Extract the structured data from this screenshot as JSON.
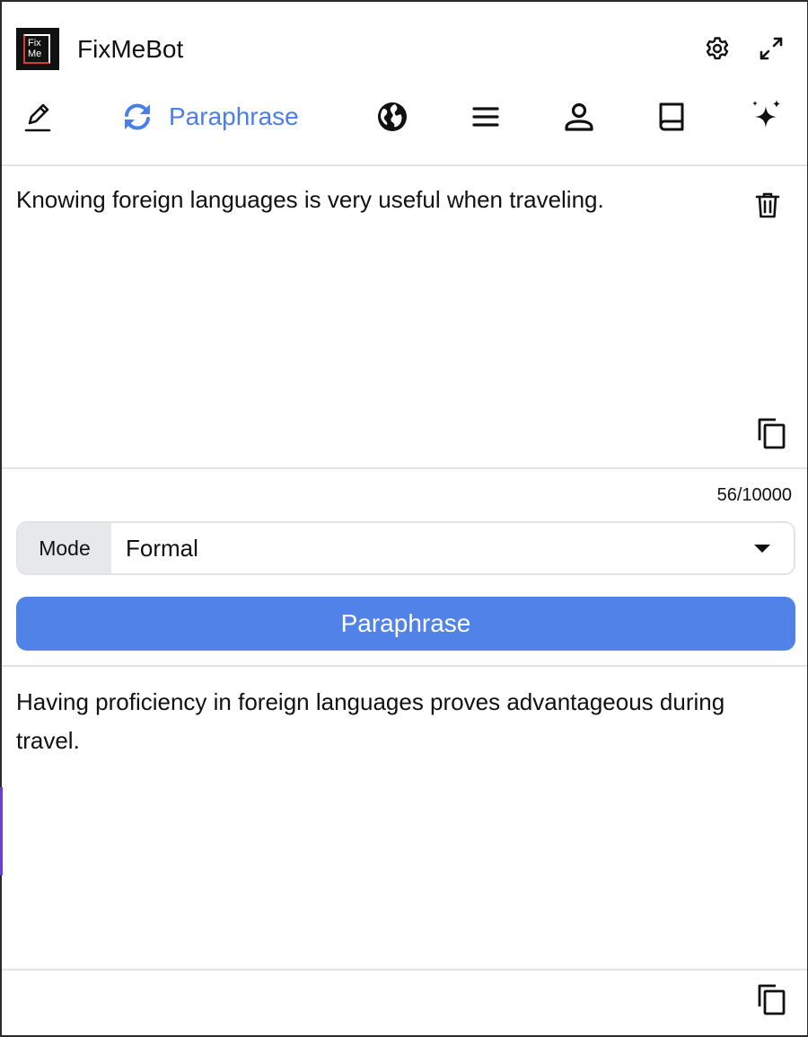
{
  "app": {
    "title": "FixMeBot",
    "logo_line1": "Fix",
    "logo_line2": "Me"
  },
  "header": {
    "settings_icon": "gear-icon",
    "expand_icon": "expand-arrows-icon"
  },
  "tabs": [
    {
      "id": "proofread",
      "icon": "pen-underline-icon",
      "label": "",
      "active": false
    },
    {
      "id": "paraphrase",
      "icon": "refresh-arrows-icon",
      "label": "Paraphrase",
      "active": true
    },
    {
      "id": "translate",
      "icon": "globe-icon",
      "label": "",
      "active": false
    },
    {
      "id": "summarize",
      "icon": "lines-icon",
      "label": "",
      "active": false
    },
    {
      "id": "persona",
      "icon": "person-icon",
      "label": "",
      "active": false
    },
    {
      "id": "dictionary",
      "icon": "book-icon",
      "label": "",
      "active": false
    },
    {
      "id": "ai",
      "icon": "sparkles-icon",
      "label": "",
      "active": false
    }
  ],
  "input": {
    "text": "Knowing foreign languages is very useful when traveling.",
    "char_count": "56/10000"
  },
  "mode": {
    "label": "Mode",
    "selected": "Formal"
  },
  "action": {
    "label": "Paraphrase"
  },
  "output": {
    "text": "Having proficiency in foreign languages proves advantageous during travel."
  },
  "colors": {
    "accent": "#4a7ee8",
    "button": "#5082e8",
    "text": "#111111",
    "divider": "#e4e4e4"
  }
}
